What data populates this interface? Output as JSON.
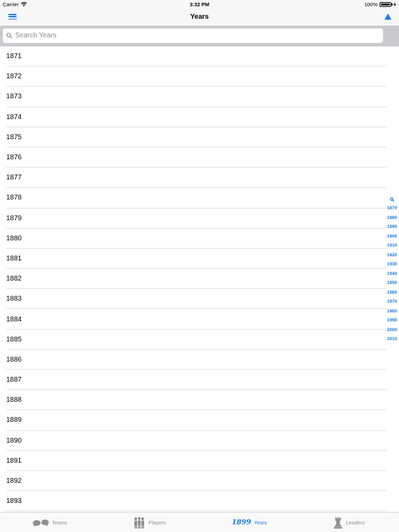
{
  "status_bar": {
    "carrier": "Carrier",
    "time": "3:32 PM",
    "battery": "100%"
  },
  "nav": {
    "title": "Years",
    "menu_icon": "hamburger-menu-icon",
    "up_icon": "triangle-up-icon"
  },
  "search": {
    "placeholder": "Search Years",
    "value": ""
  },
  "years": [
    "1871",
    "1872",
    "1873",
    "1874",
    "1875",
    "1876",
    "1877",
    "1878",
    "1879",
    "1880",
    "1881",
    "1882",
    "1883",
    "1884",
    "1885",
    "1886",
    "1887",
    "1888",
    "1889",
    "1890",
    "1891",
    "1892",
    "1893"
  ],
  "section_index": [
    "1870",
    "1880",
    "1890",
    "1900",
    "1910",
    "1920",
    "1930",
    "1940",
    "1950",
    "1960",
    "1970",
    "1980",
    "1990",
    "2000",
    "2010"
  ],
  "tabs": [
    {
      "label": "Teams",
      "icon": "teams-icon",
      "active": false
    },
    {
      "label": "Players",
      "icon": "players-icon",
      "active": false
    },
    {
      "label": "Years",
      "icon": "years-icon",
      "icon_text": "1899",
      "active": true
    },
    {
      "label": "Leaders",
      "icon": "trophy-icon",
      "active": false
    }
  ],
  "colors": {
    "accent": "#1a7ae6",
    "inactive": "#8e8e93",
    "search_bg": "#c9c9ce",
    "bar_bg": "#f7f7f7"
  }
}
